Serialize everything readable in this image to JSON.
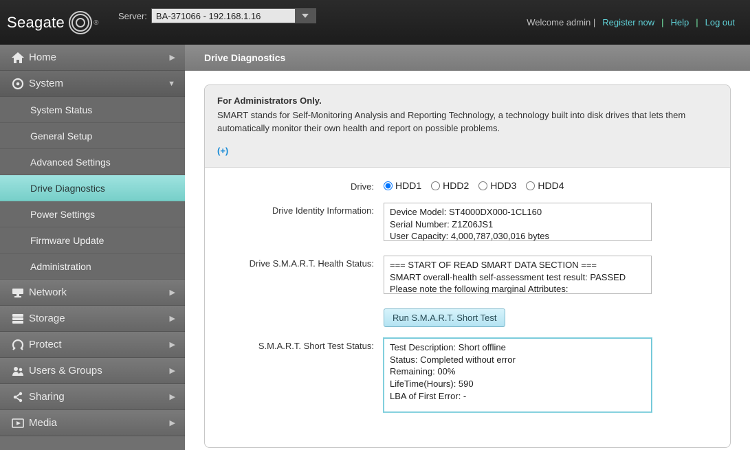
{
  "header": {
    "brand": "Seagate",
    "server_label": "Server:",
    "server_value": "BA-371066 - 192.168.1.16",
    "welcome": "Welcome admin |",
    "register": "Register now",
    "help": "Help",
    "logout": "Log out"
  },
  "sidebar": {
    "home": "Home",
    "system": "System",
    "system_items": {
      "status": "System Status",
      "general": "General Setup",
      "advanced": "Advanced Settings",
      "diag": "Drive Diagnostics",
      "power": "Power Settings",
      "firmware": "Firmware Update",
      "admin": "Administration"
    },
    "network": "Network",
    "storage": "Storage",
    "protect": "Protect",
    "users": "Users & Groups",
    "sharing": "Sharing",
    "media": "Media"
  },
  "page": {
    "title": "Drive Diagnostics",
    "box_header": "For Administrators Only.",
    "box_text": "SMART stands for Self-Monitoring Analysis and Reporting Technology, a technology built into disk drives that lets them automatically monitor their own health and report on possible problems.",
    "expand": "(+)",
    "labels": {
      "drive": "Drive:",
      "identity": "Drive Identity Information:",
      "health": "Drive S.M.A.R.T. Health Status:",
      "short_status": "S.M.A.R.T. Short Test Status:"
    },
    "drives": {
      "d1": "HDD1",
      "d2": "HDD2",
      "d3": "HDD3",
      "d4": "HDD4"
    },
    "identity_text": "Device Model: ST4000DX000-1CL160\nSerial Number: Z1Z06JS1\nUser Capacity: 4,000,787,030,016 bytes",
    "health_text": "=== START OF READ SMART DATA SECTION ===\nSMART overall-health self-assessment test result: PASSED\nPlease note the following marginal Attributes:",
    "run_button": "Run S.M.A.R.T. Short Test",
    "short_text": "Test Description: Short offline\nStatus: Completed without error\nRemaining: 00%\nLifeTime(Hours): 590\nLBA of First Error: -"
  }
}
